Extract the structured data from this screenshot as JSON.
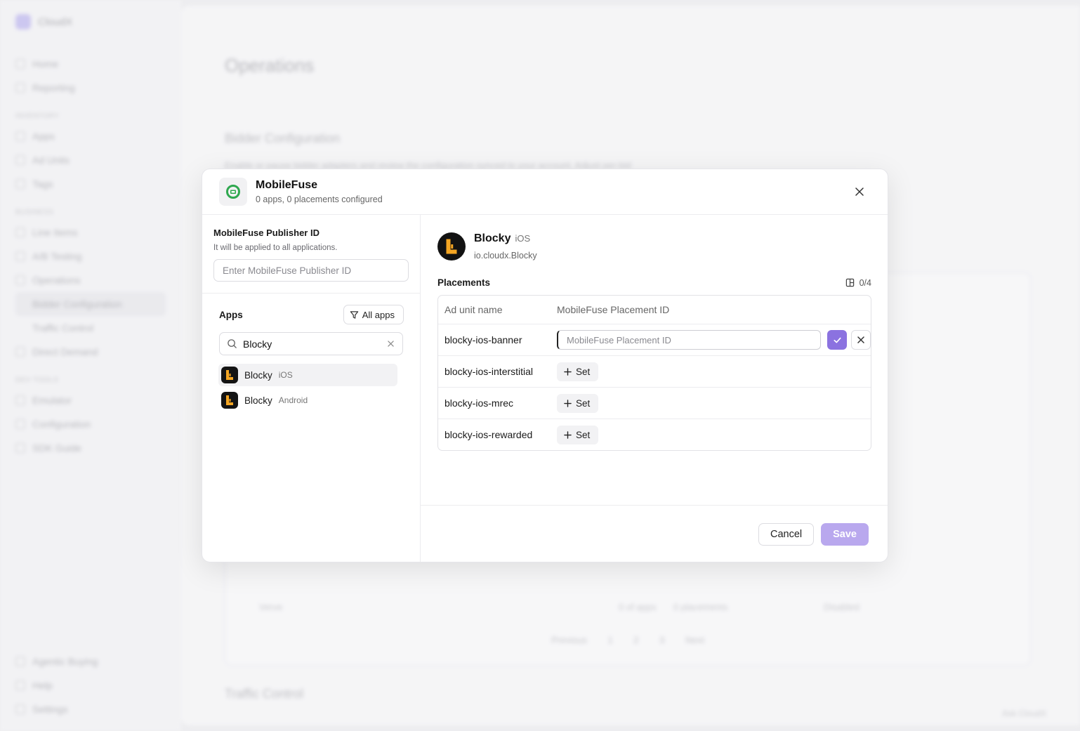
{
  "background": {
    "brand": "CloudX",
    "nav_top": [
      "Home",
      "Reporting"
    ],
    "section_inventory": "INVENTORY",
    "nav_inventory": [
      "Apps",
      "Ad Units",
      "Tags"
    ],
    "section_business": "BUSINESS",
    "nav_business": [
      "Line Items",
      "A/B Testing",
      "Operations"
    ],
    "nav_operations_sub": [
      "Bidder Configuration",
      "Traffic Control"
    ],
    "nav_direct": "Direct Demand",
    "section_dev": "DEV TOOLS",
    "nav_dev": [
      "Emulator",
      "Configuration",
      "SDK Guide"
    ],
    "nav_bottom": [
      "Agentic Buying",
      "Help",
      "Settings"
    ],
    "page_title": "Operations",
    "section_title": "Bidder Configuration",
    "section_desc": "Enable or pause bidder adapters and review the configuration synced to your account. Adjust per-bid settings from the open bidder adapter.",
    "row_label": "Verve",
    "row_apps": "0 of apps",
    "row_placements": "0 placements",
    "row_status": "Disabled",
    "pager": [
      "Previous",
      "1",
      "2",
      "3",
      "Next"
    ],
    "section_title_2": "Traffic Control",
    "footer_label": "Ask CloudX"
  },
  "modal": {
    "provider_name": "MobileFuse",
    "provider_summary": "0 apps, 0 placements configured",
    "publisher_label": "MobileFuse Publisher ID",
    "publisher_help": "It will be applied to all applications.",
    "publisher_placeholder": "Enter MobileFuse Publisher ID",
    "apps_title": "Apps",
    "all_apps_label": "All apps",
    "search_value": "Blocky",
    "apps": [
      {
        "name": "Blocky",
        "platform": "iOS"
      },
      {
        "name": "Blocky",
        "platform": "Android"
      }
    ],
    "selected_app": {
      "name": "Blocky",
      "platform": "iOS",
      "bundle": "io.cloudx.Blocky"
    },
    "placements_title": "Placements",
    "placements_count": "0/4",
    "table_headers": [
      "Ad unit name",
      "MobileFuse Placement ID"
    ],
    "placement_id_placeholder": "MobileFuse Placement ID",
    "set_label": "Set",
    "ad_units": [
      "blocky-ios-banner",
      "blocky-ios-interstitial",
      "blocky-ios-mrec",
      "blocky-ios-rewarded"
    ],
    "cancel_label": "Cancel",
    "save_label": "Save"
  },
  "colors": {
    "accent": "#8b72e0",
    "accent_disabled": "#b9a8ee",
    "provider_green": "#2fa84f"
  }
}
